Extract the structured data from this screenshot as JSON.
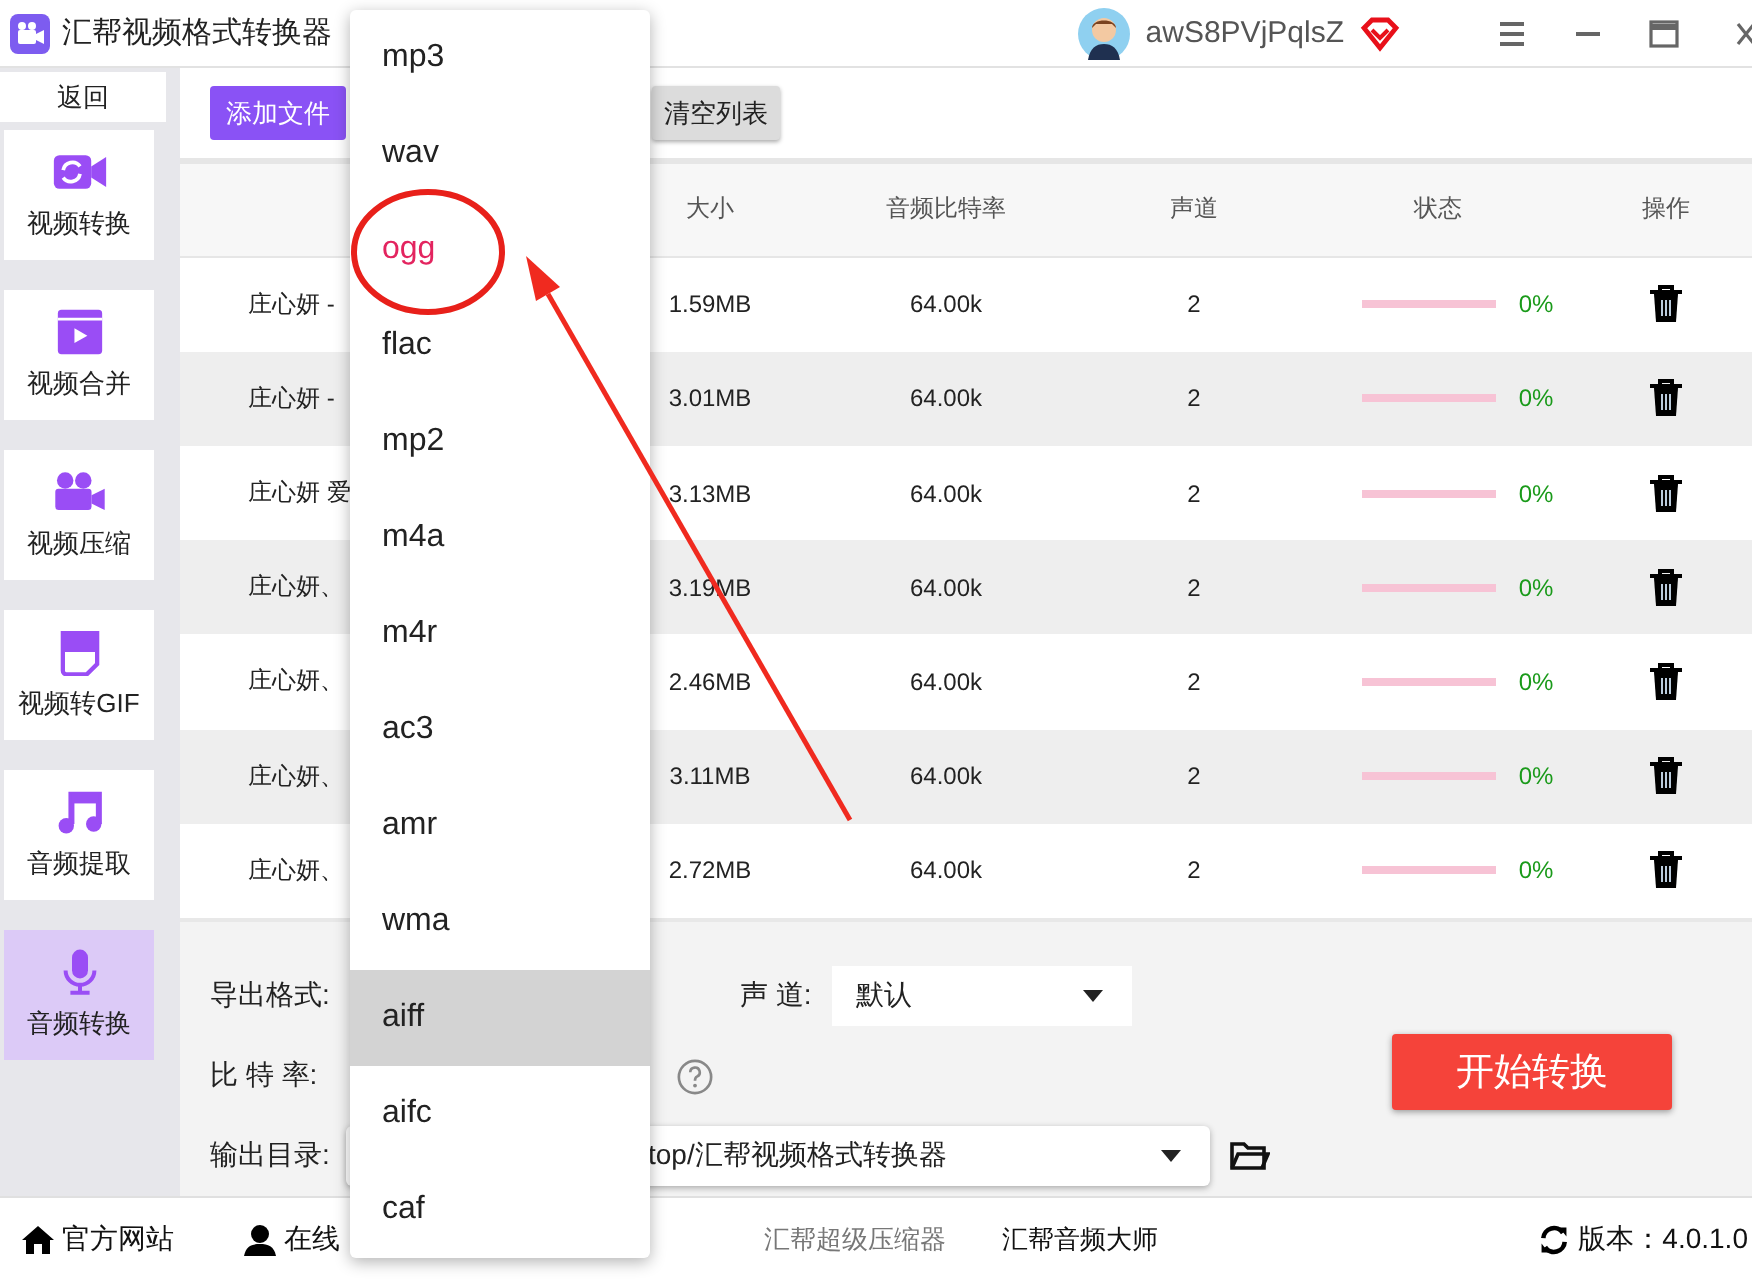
{
  "window": {
    "title": "汇帮视频格式转换器",
    "username": "awS8PVjPqlsZ"
  },
  "sidebar": {
    "back": "返回",
    "items": [
      {
        "label": "视频转换",
        "selected": false
      },
      {
        "label": "视频合并",
        "selected": false
      },
      {
        "label": "视频压缩",
        "selected": false
      },
      {
        "label": "视频转GIF",
        "selected": false
      },
      {
        "label": "音频提取",
        "selected": false
      },
      {
        "label": "音频转换",
        "selected": true
      }
    ]
  },
  "toolbar": {
    "add": "添加文件",
    "clear": "清空列表"
  },
  "table": {
    "columns": [
      "",
      "大小",
      "音频比特率",
      "声道",
      "状态",
      "操作"
    ],
    "rows": [
      {
        "name": "庄心妍 -",
        "size": "1.59MB",
        "bitrate": "64.00k",
        "channels": "2",
        "level": 0,
        "reading": "0%"
      },
      {
        "name": "庄心妍 -",
        "size": "3.01MB",
        "bitrate": "64.00k",
        "channels": "2",
        "level": 0,
        "reading": "0%"
      },
      {
        "name": "庄心妍 爱",
        "size": "3.13MB",
        "bitrate": "64.00k",
        "channels": "2",
        "level": 0,
        "reading": "0%"
      },
      {
        "name": "庄心妍、",
        "size": "3.19MB",
        "bitrate": "64.00k",
        "channels": "2",
        "level": 0,
        "reading": "0%"
      },
      {
        "name": "庄心妍、",
        "size": "2.46MB",
        "bitrate": "64.00k",
        "channels": "2",
        "level": 0,
        "reading": "0%"
      },
      {
        "name": "庄心妍、",
        "size": "3.11MB",
        "bitrate": "64.00k",
        "channels": "2",
        "level": 0,
        "reading": "0%"
      },
      {
        "name": "庄心妍、",
        "size": "2.72MB",
        "bitrate": "64.00k",
        "channels": "2",
        "level": 0,
        "reading": "0%"
      }
    ]
  },
  "settings": {
    "format_label": "导出格式:",
    "channel_label": "声 道:",
    "channel_value": "默认",
    "bitrate_label": "比 特 率:",
    "output_label": "输出目录:",
    "output_value": "top/汇帮视频格式转换器",
    "start": "开始转换"
  },
  "format_menu": [
    {
      "label": "mp3",
      "selected": false,
      "highlighted": false
    },
    {
      "label": "wav",
      "selected": false,
      "highlighted": false
    },
    {
      "label": "ogg",
      "selected": true,
      "highlighted": false
    },
    {
      "label": "flac",
      "selected": false,
      "highlighted": false
    },
    {
      "label": "mp2",
      "selected": false,
      "highlighted": false
    },
    {
      "label": "m4a",
      "selected": false,
      "highlighted": false
    },
    {
      "label": "m4r",
      "selected": false,
      "highlighted": false
    },
    {
      "label": "ac3",
      "selected": false,
      "highlighted": false
    },
    {
      "label": "amr",
      "selected": false,
      "highlighted": false
    },
    {
      "label": "wma",
      "selected": false,
      "highlighted": false
    },
    {
      "label": "aiff",
      "selected": false,
      "highlighted": true
    },
    {
      "label": "aifc",
      "selected": false,
      "highlighted": false
    },
    {
      "label": "caf",
      "selected": false,
      "highlighted": false
    }
  ],
  "footer": {
    "site": "官方网站",
    "service": "在线",
    "links": [
      "汇帮超级压缩器",
      "汇帮音频大师"
    ],
    "version": "版本：4.0.1.0"
  }
}
